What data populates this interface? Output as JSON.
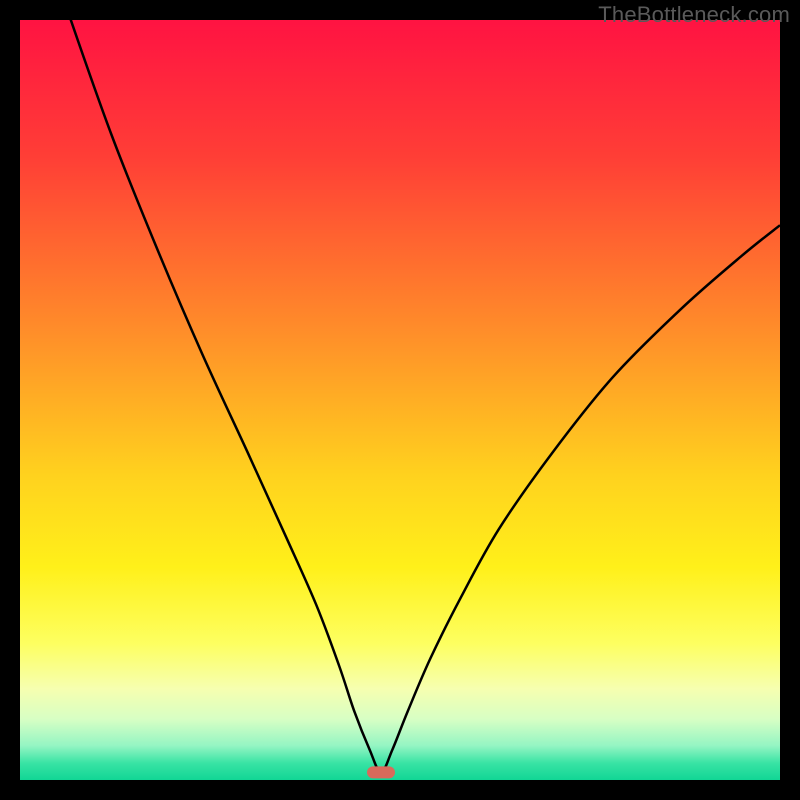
{
  "watermark": "TheBottleneck.com",
  "colors": {
    "frame": "#000000",
    "watermark": "#5a5a5a",
    "curve": "#000000",
    "marker": "#d86a5b",
    "gradient_stops": [
      {
        "offset": 0.0,
        "color": "#ff1342"
      },
      {
        "offset": 0.18,
        "color": "#ff3e36"
      },
      {
        "offset": 0.4,
        "color": "#ff8a2a"
      },
      {
        "offset": 0.6,
        "color": "#ffd21e"
      },
      {
        "offset": 0.72,
        "color": "#fff01a"
      },
      {
        "offset": 0.82,
        "color": "#fdff60"
      },
      {
        "offset": 0.88,
        "color": "#f6ffb0"
      },
      {
        "offset": 0.92,
        "color": "#d7ffc4"
      },
      {
        "offset": 0.955,
        "color": "#94f5c3"
      },
      {
        "offset": 0.978,
        "color": "#38e3a4"
      },
      {
        "offset": 1.0,
        "color": "#11d695"
      }
    ]
  },
  "chart_data": {
    "type": "line",
    "title": "",
    "xlabel": "",
    "ylabel": "",
    "xlim": [
      0,
      100
    ],
    "ylim": [
      0,
      100
    ],
    "grid": false,
    "marker": {
      "x": 47.5,
      "y": 1
    },
    "series": [
      {
        "name": "bottleneck-curve",
        "x": [
          0,
          6,
          12,
          18,
          24,
          30,
          35,
          39,
          42,
          44,
          46,
          47.5,
          49,
          51,
          54,
          58,
          63,
          70,
          78,
          87,
          95,
          100
        ],
        "values": [
          120,
          102,
          85,
          70,
          56,
          43,
          32,
          23,
          15,
          9,
          4,
          1,
          4,
          9,
          16,
          24,
          33,
          43,
          53,
          62,
          69,
          73
        ]
      }
    ]
  }
}
